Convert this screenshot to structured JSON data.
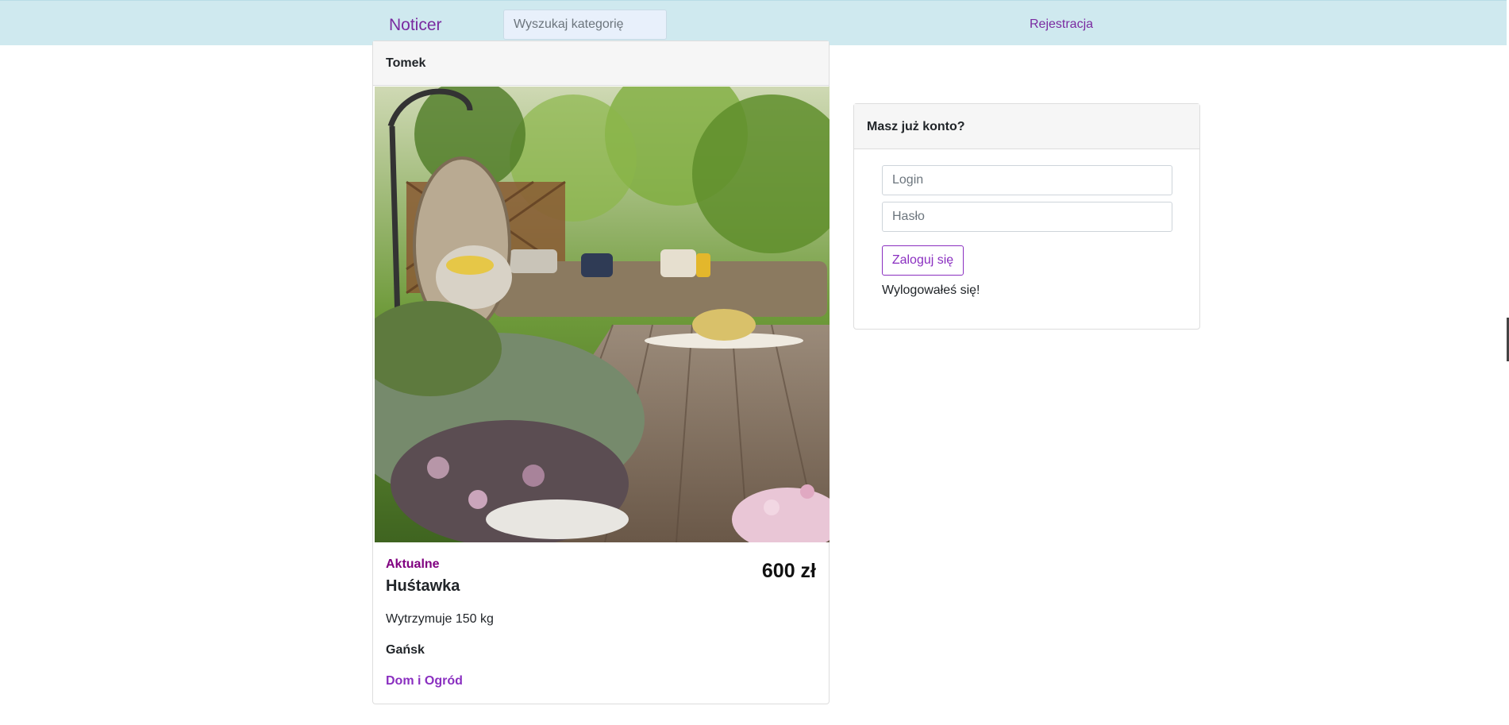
{
  "navbar": {
    "brand": "Noticer",
    "search_placeholder": "Wyszukaj kategorię",
    "register_link": "Rejestracja"
  },
  "post": {
    "author": "Tomek",
    "status": "Aktualne",
    "title": "Huśtawka",
    "price": "600 zł",
    "description": "Wytrzymuje 150 kg",
    "city": "Gańsk",
    "category": "Dom i Ogród"
  },
  "login": {
    "header": "Masz już konto?",
    "login_placeholder": "Login",
    "password_placeholder": "Hasło",
    "submit_label": "Zaloguj się",
    "message": "Wylogowałeś się!"
  },
  "colors": {
    "navbar_bg": "#cfe9ef",
    "accent": "#8a2fc0",
    "status": "#800080"
  }
}
